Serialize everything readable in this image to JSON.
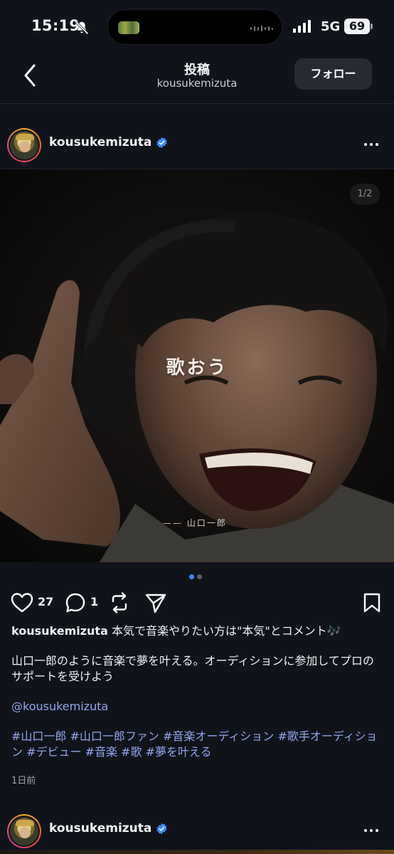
{
  "status_bar": {
    "time": "15:19",
    "network": "5G",
    "battery": "69"
  },
  "nav": {
    "title": "投稿",
    "subtitle": "kousukemizuta",
    "follow_label": "フォロー"
  },
  "post": {
    "username": "kousukemizuta",
    "verified": true,
    "image": {
      "page_indicator": "1/2",
      "overlay_text": "歌おう",
      "overlay_attribution": "—— 山口一郎",
      "carousel_current": 1,
      "carousel_total": 2
    },
    "actions": {
      "likes": "27",
      "comments": "1"
    },
    "caption": {
      "username": "kousukemizuta",
      "first_line": "本気で音楽やりたい方は\"本気\"とコメント🎶",
      "body": "山口一郎のように音楽で夢を叶える。オーディションに参加してプロのサポートを受けよう",
      "mention": "@kousukemizuta",
      "hashtags": "#山口一郎 #山口一郎ファン #音楽オーディション #歌手オーディション #デビュー #音楽 #歌 #夢を叶える"
    },
    "time_ago": "1日前"
  },
  "next_post": {
    "username": "kousukemizuta",
    "verified": true
  },
  "colors": {
    "background": "#10131a",
    "link": "#93a6f2",
    "verified": "#3d8bff",
    "carousel_active": "#3d8bff",
    "carousel_inactive": "#5a5f68",
    "follow_button": "#252a33"
  }
}
